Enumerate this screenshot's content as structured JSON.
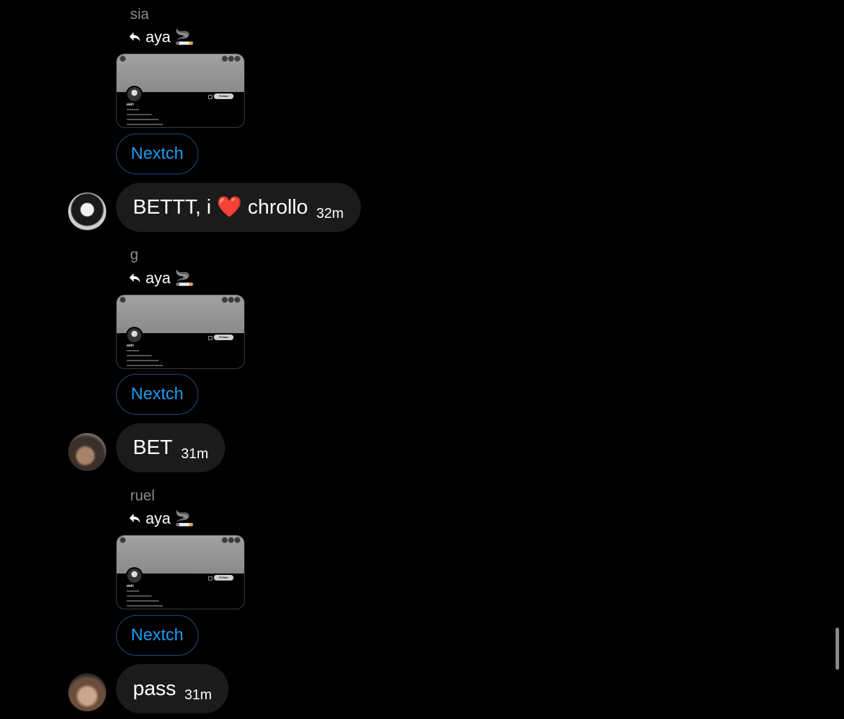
{
  "reply_header": {
    "name": "aya",
    "emoji": "🚬"
  },
  "card": {
    "name": "aiah",
    "follow_label": "Follow"
  },
  "blocks": [
    {
      "sender": "sia",
      "chip_label": "Nextch",
      "message": {
        "text_before": "BETTT, i",
        "emoji": "❤️",
        "text_after": "chrollo",
        "time": "32m"
      }
    },
    {
      "sender": "g",
      "chip_label": "Nextch",
      "message": {
        "text": "BET",
        "time": "31m"
      }
    },
    {
      "sender": "ruel",
      "chip_label": "Nextch",
      "message": {
        "text": "pass",
        "time": "31m"
      }
    }
  ],
  "colors": {
    "background": "#000000",
    "bubble": "#1b1b1b",
    "chip_text": "#1d9bf0",
    "chip_border": "#1d4f80",
    "sender": "#8b8b8b"
  }
}
